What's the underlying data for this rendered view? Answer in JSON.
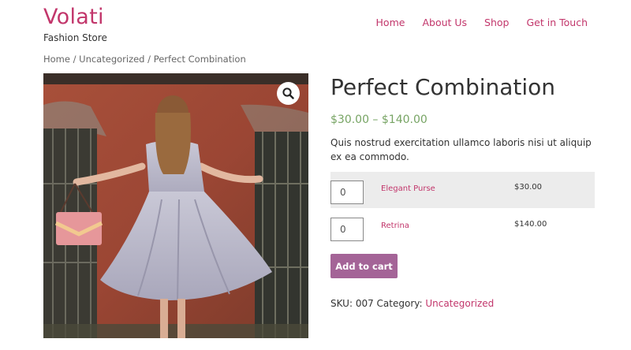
{
  "site": {
    "name": "Volati",
    "tagline": "Fashion Store"
  },
  "nav": {
    "items": [
      "Home",
      "About Us",
      "Shop",
      "Get in Touch"
    ]
  },
  "breadcrumb": {
    "home": "Home",
    "sep1": " / ",
    "category": "Uncategorized",
    "sep2": " / ",
    "current": "Perfect Combination"
  },
  "product": {
    "title": "Perfect Combination",
    "price": "$30.00 – $140.00",
    "description": "Quis nostrud exercitation ullamco laboris nisi ut aliquip ex ea commodo.",
    "grouped": [
      {
        "qty": "0",
        "name": "Elegant Purse",
        "price": "$30.00"
      },
      {
        "qty": "0",
        "name": "Retrina",
        "price": "$140.00"
      }
    ],
    "add_to_cart": "Add to cart",
    "sku_label": "SKU: ",
    "sku": "007",
    "category_label": " Category: ",
    "category": "Uncategorized"
  },
  "colors": {
    "accent": "#c2366b",
    "price": "#77a464",
    "button": "#a46497"
  }
}
